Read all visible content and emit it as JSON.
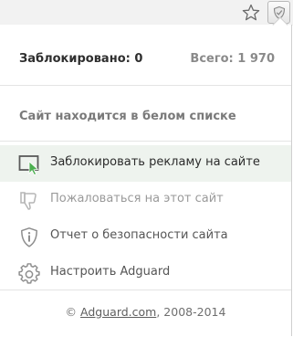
{
  "toolbar": {
    "star_icon": "star-icon",
    "extension_icon": "adguard-shield-icon"
  },
  "stats": {
    "blocked_label": "Заблокировано: 0",
    "total_label": "Всего: 1 970"
  },
  "status": {
    "text": "Сайт находится в белом списке"
  },
  "menu": {
    "items": [
      {
        "label": "Заблокировать рекламу на сайте",
        "icon": "block-ads-icon",
        "state": "active"
      },
      {
        "label": "Пожаловаться на этот сайт",
        "icon": "thumbs-down-icon",
        "state": "disabled"
      },
      {
        "label": "Отчет о безопасности сайта",
        "icon": "shield-info-icon",
        "state": "normal"
      },
      {
        "label": "Настроить Adguard",
        "icon": "gear-icon",
        "state": "normal"
      }
    ]
  },
  "footer": {
    "copyright": "©",
    "link_text": "Adguard.com",
    "years": ", 2008-2014"
  },
  "colors": {
    "accent_green": "#4cb050",
    "active_row_bg": "#eef3ee",
    "icon_gray": "#8e8e8e"
  }
}
